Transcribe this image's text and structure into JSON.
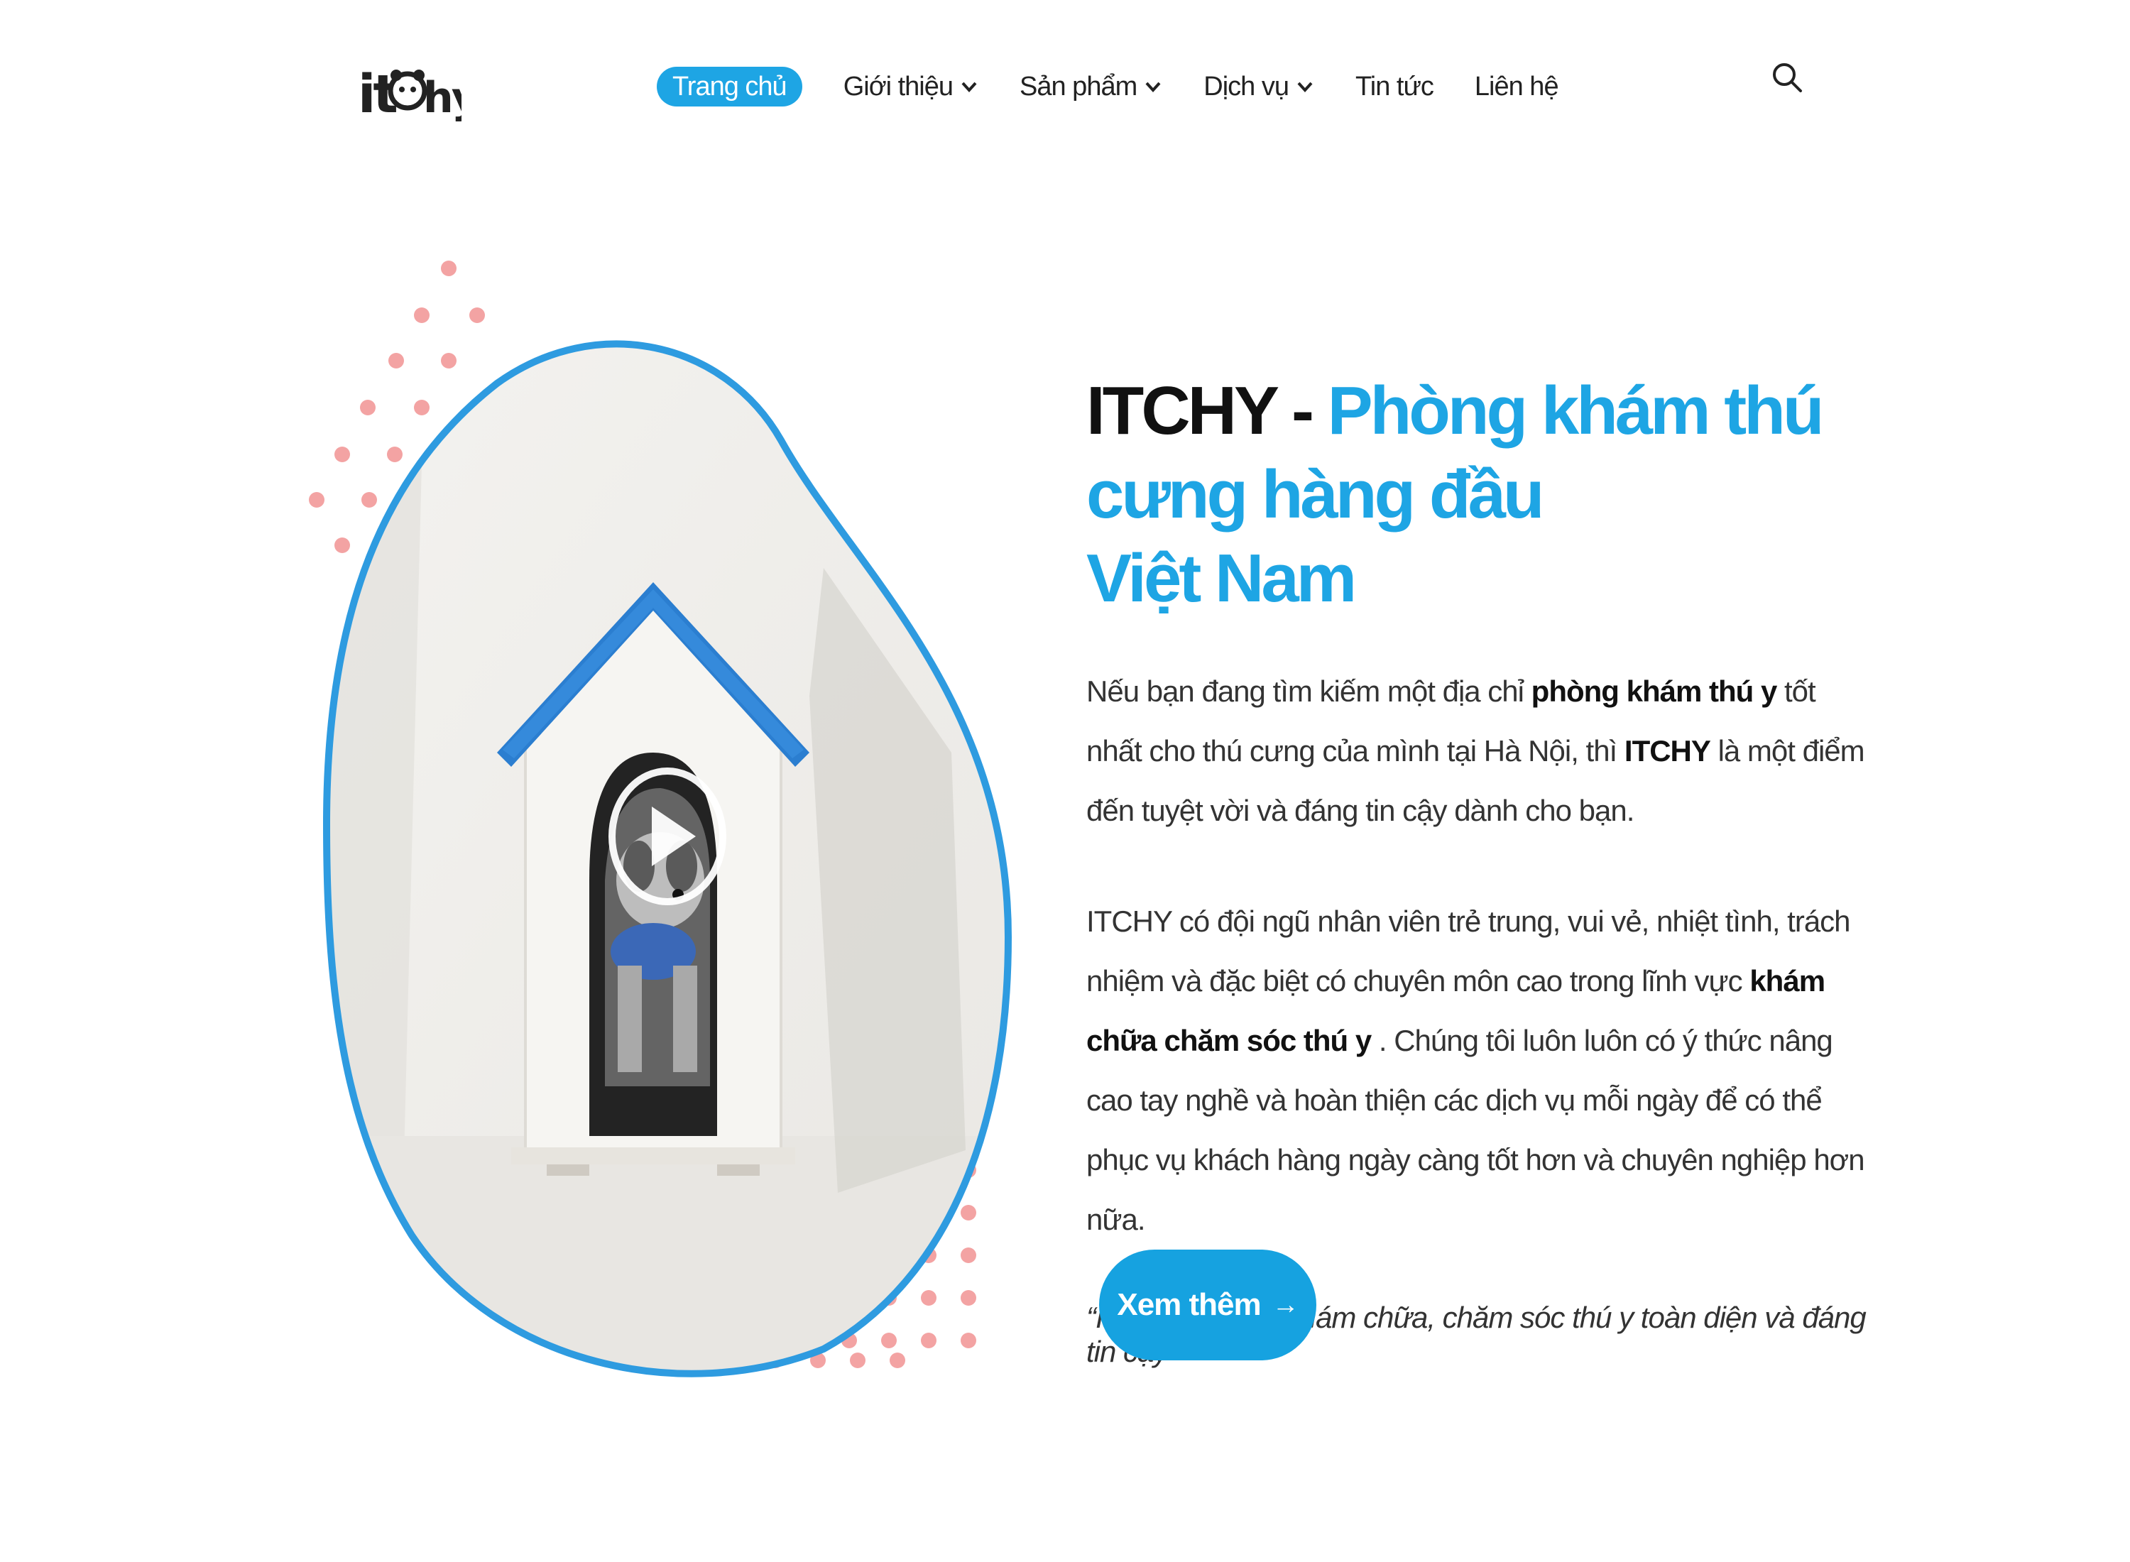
{
  "header": {
    "logo_text": "itchy",
    "nav": [
      {
        "label": "Trang chủ",
        "active": true,
        "has_dropdown": false
      },
      {
        "label": "Giới thiệu",
        "active": false,
        "has_dropdown": true
      },
      {
        "label": "Sản phẩm",
        "active": false,
        "has_dropdown": true
      },
      {
        "label": "Dịch vụ",
        "active": false,
        "has_dropdown": true
      },
      {
        "label": "Tin tức",
        "active": false,
        "has_dropdown": false
      },
      {
        "label": "Liên hệ",
        "active": false,
        "has_dropdown": false
      }
    ],
    "search_icon": "search-icon",
    "dropdown_icon": "chevron-down-icon"
  },
  "hero": {
    "title_brand": "ITCHY - ",
    "title_highlight_1": "Phòng khám thú cưng hàng đầu",
    "title_highlight_2": "Việt Nam",
    "p1": {
      "a": "Nếu bạn đang tìm kiếm một địa chỉ ",
      "b": "phòng khám thú y",
      "c": " tốt nhất cho thú cưng của mình tại  Hà Nội, thì ",
      "d": "ITCHY",
      "e": "  là một điểm đến tuyệt vời và đáng tin cậy dành cho bạn."
    },
    "p2": {
      "a": "ITCHY có đội ngũ nhân viên trẻ trung, vui vẻ, nhiệt tình, trách nhiệm và đặc biệt có chuyên môn cao  trong lĩnh vực  ",
      "b": "khám chữa chăm sóc thú y",
      "c": " . Chúng tôi luôn luôn có ý thức nâng cao tay nghề và hoàn thiện các dịch vụ mỗi ngày để có thể phục vụ khách hàng ngày càng tốt hơn và chuyên nghiệp hơn nữa."
    },
    "quote": "“ITCHY dịch vụ khám chữa, chăm sóc thú y toàn diện và đáng tin cậy”",
    "cta_label": "Xem thêm",
    "cta_icon": "→",
    "play_icon": "play-icon"
  },
  "colors": {
    "accent": "#1ea5e4",
    "dots": "#f3a3a3",
    "text": "#333333"
  }
}
